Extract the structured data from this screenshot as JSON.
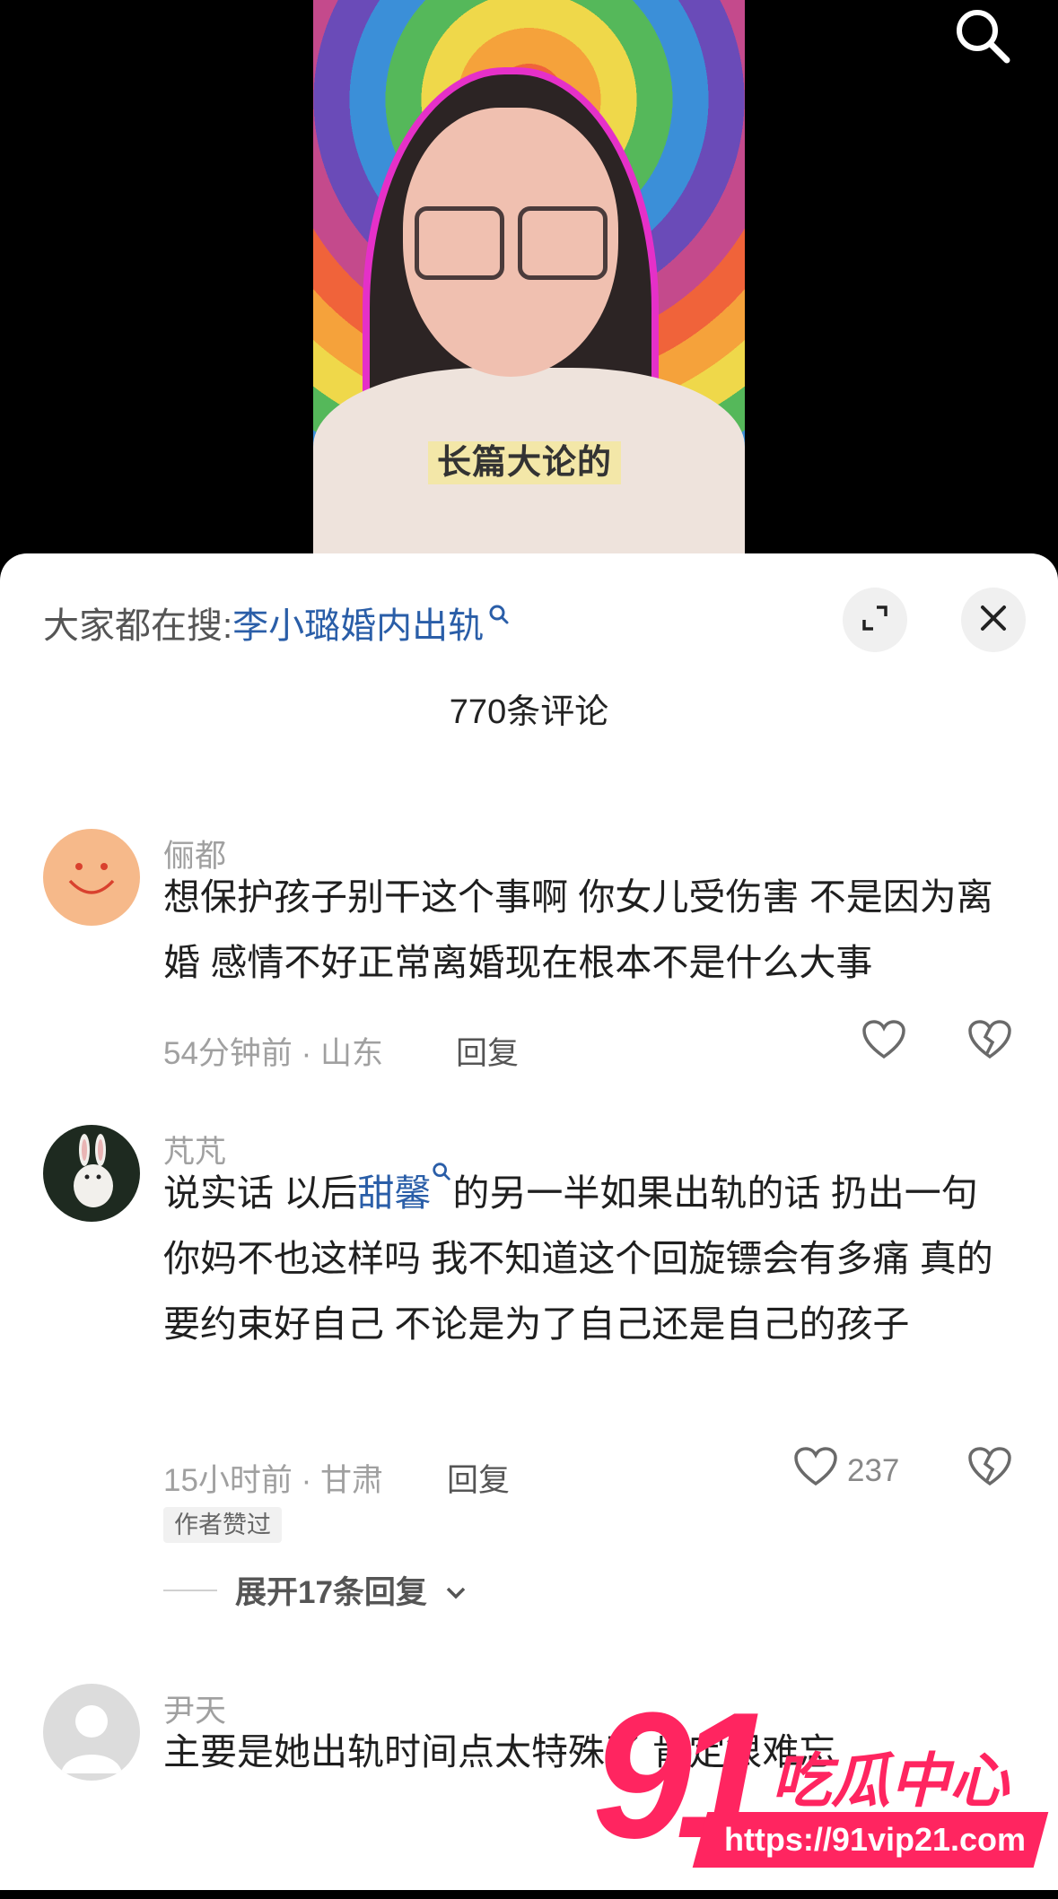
{
  "video": {
    "caption": "长篇大论的"
  },
  "sheet": {
    "hot_search_prefix": "大家都在搜:",
    "hot_search_term": "李小璐婚内出轨",
    "comment_count": "770条评论"
  },
  "comments": [
    {
      "username": "俪都",
      "text": "想保护孩子别干这个事啊 你女儿受伤害 不是因为离婚 感情不好正常离婚现在根本不是什么大事",
      "meta": "54分钟前 · 山东",
      "reply_label": "回复",
      "likes": ""
    },
    {
      "username": "芃芃",
      "text_before": "说实话 以后",
      "link": "甜馨",
      "text_after": "的另一半如果出轨的话 扔出一句 你妈不也这样吗 我不知道这个回旋镖会有多痛 真的要约束好自己 不论是为了自己还是自己的孩子",
      "meta": "15小时前 · 甘肃",
      "reply_label": "回复",
      "likes": "237",
      "tag": "作者赞过",
      "expand_label": "展开17条回复"
    },
    {
      "username": "尹天",
      "text": "主要是她出轨时间点太特殊了 肯定很难忘"
    }
  ],
  "watermark": {
    "number": "91",
    "text": "吃瓜中心",
    "url": "https://91vip21.com"
  },
  "colors": {
    "accent_blue": "#2a5ea8",
    "watermark_pink": "#ff2560"
  }
}
